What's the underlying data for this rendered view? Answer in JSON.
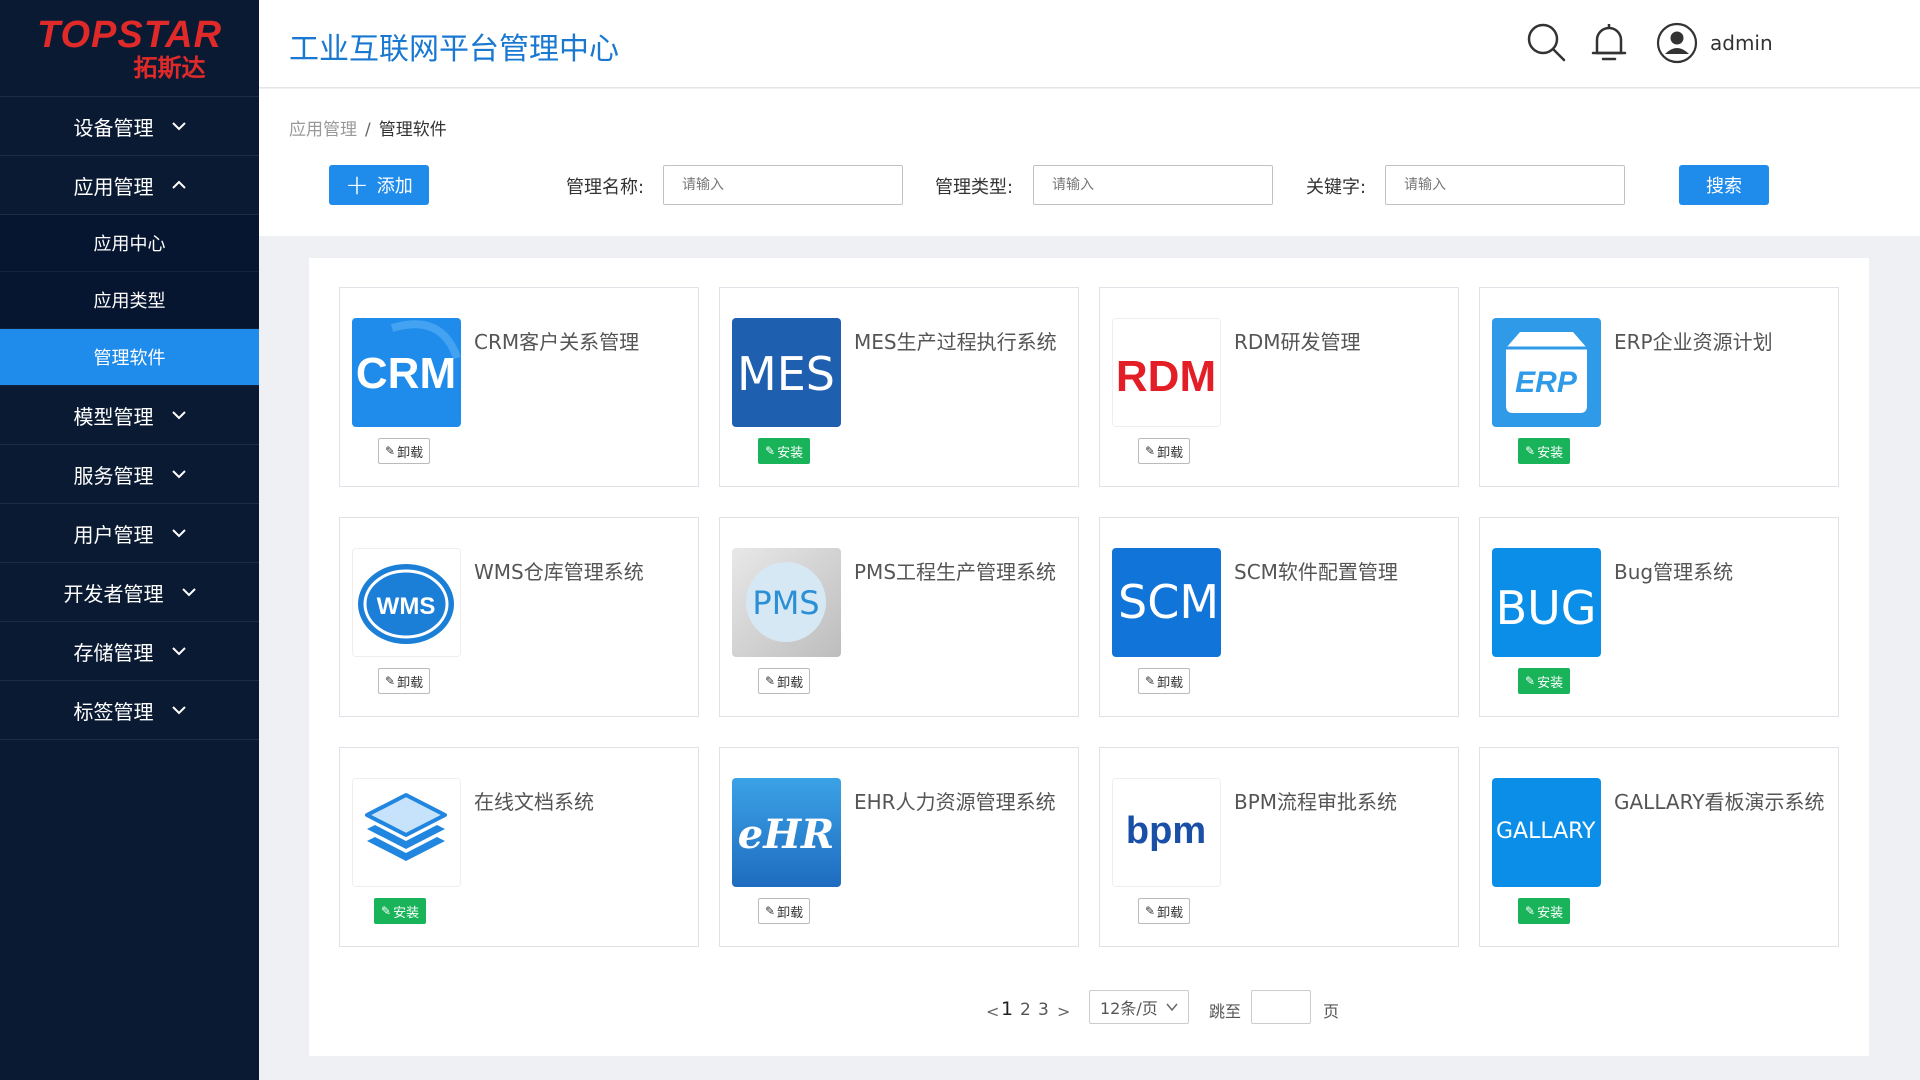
{
  "brand": {
    "name": "TOPSTAR",
    "sub": "拓斯达"
  },
  "header": {
    "title": "工业互联网平台管理中心",
    "username": "admin"
  },
  "sidebar": {
    "items": [
      {
        "label": "设备管理",
        "expanded": false
      },
      {
        "label": "应用管理",
        "expanded": true,
        "children": [
          {
            "label": "应用中心",
            "active": false
          },
          {
            "label": "应用类型",
            "active": false
          },
          {
            "label": "管理软件",
            "active": true
          }
        ]
      },
      {
        "label": "模型管理",
        "expanded": false
      },
      {
        "label": "服务管理",
        "expanded": false
      },
      {
        "label": "用户管理",
        "expanded": false
      },
      {
        "label": "开发者管理",
        "expanded": false
      },
      {
        "label": "存储管理",
        "expanded": false
      },
      {
        "label": "标签管理",
        "expanded": false
      }
    ]
  },
  "breadcrumb": {
    "parent": "应用管理",
    "separator": "/",
    "current": "管理软件"
  },
  "toolbar": {
    "add_label": "添加",
    "filters": [
      {
        "label": "管理名称:",
        "placeholder": "请输入"
      },
      {
        "label": "管理类型:",
        "placeholder": "请输入"
      },
      {
        "label": "关键字:",
        "placeholder": "请输入"
      }
    ],
    "search_label": "搜索"
  },
  "apps": [
    {
      "name": "CRM客户关系管理",
      "logo_text": "CRM",
      "action": "卸载",
      "state": "uninstall"
    },
    {
      "name": "MES生产过程执行系统",
      "logo_text": "MES",
      "action": "安装",
      "state": "install"
    },
    {
      "name": "RDM研发管理",
      "logo_text": "RDM",
      "action": "卸载",
      "state": "uninstall"
    },
    {
      "name": "ERP企业资源计划",
      "logo_text": "ERP",
      "action": "安装",
      "state": "install"
    },
    {
      "name": "WMS仓库管理系统",
      "logo_text": "WMS",
      "action": "卸载",
      "state": "uninstall"
    },
    {
      "name": "PMS工程生产管理系统",
      "logo_text": "PMS",
      "action": "卸载",
      "state": "uninstall"
    },
    {
      "name": "SCM软件配置管理",
      "logo_text": "SCM",
      "action": "卸载",
      "state": "uninstall"
    },
    {
      "name": "Bug管理系统",
      "logo_text": "BUG",
      "action": "安装",
      "state": "install"
    },
    {
      "name": "在线文档系统",
      "logo_text": "",
      "action": "安装",
      "state": "install"
    },
    {
      "name": "EHR人力资源管理系统",
      "logo_text": "eHR",
      "action": "卸载",
      "state": "uninstall"
    },
    {
      "name": "BPM流程审批系统",
      "logo_text": "bpm",
      "action": "卸载",
      "state": "uninstall"
    },
    {
      "name": "GALLARY看板演示系统",
      "logo_text": "GALLARY",
      "action": "安装",
      "state": "install"
    }
  ],
  "pagination": {
    "prev": "<",
    "next": ">",
    "pages": [
      "1",
      "2",
      "3"
    ],
    "current": "1",
    "page_size": "12条/页",
    "jump_label": "跳至",
    "page_unit": "页"
  },
  "colors": {
    "sidebar_bg": "#0a1a33",
    "accent": "#1f8ceb",
    "install_green": "#19b35a",
    "brand_red": "#e02a2a"
  }
}
